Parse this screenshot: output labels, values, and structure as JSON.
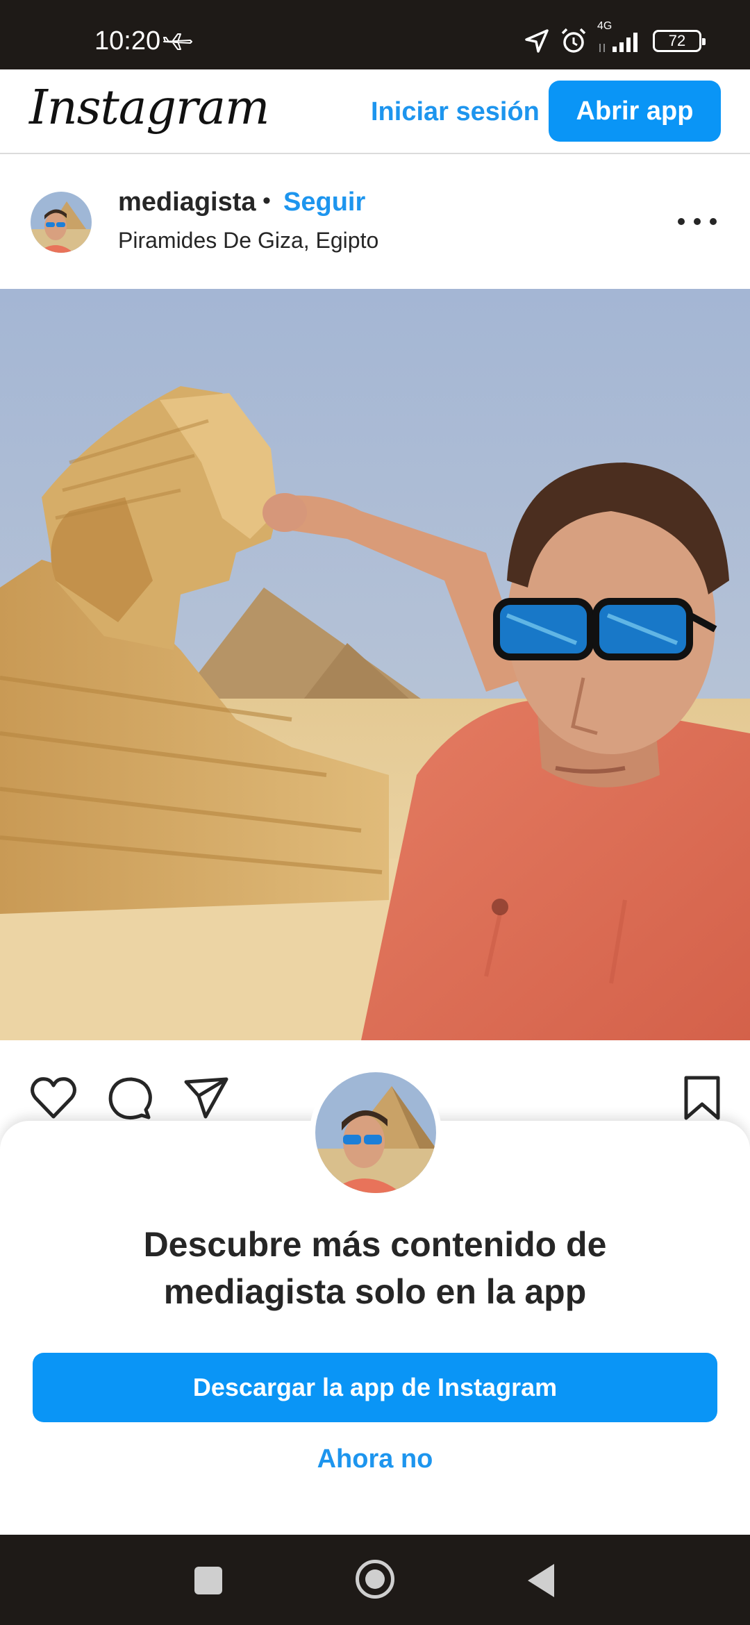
{
  "status_bar": {
    "time": "10:20",
    "network": "4G",
    "battery": "72",
    "icons": [
      "airplane-icon",
      "location-arrow-icon",
      "alarm-icon",
      "signal-icon",
      "battery-icon"
    ]
  },
  "header": {
    "logo": "Instagram",
    "login_label": "Iniciar sesión",
    "open_app_label": "Abrir app"
  },
  "post": {
    "username": "mediagista",
    "separator": "•",
    "follow_label": "Seguir",
    "location": "Piramides De Giza, Egipto",
    "actions": [
      "heart-icon",
      "comment-icon",
      "share-icon",
      "bookmark-icon"
    ]
  },
  "sheet": {
    "title": "Descubre más contenido de mediagista solo en la app",
    "download_label": "Descargar la app de Instagram",
    "not_now_label": "Ahora no"
  },
  "colors": {
    "accent": "#0a95f6",
    "link": "#1d95ee",
    "text": "#262626",
    "system_bar": "#1e1a17"
  }
}
